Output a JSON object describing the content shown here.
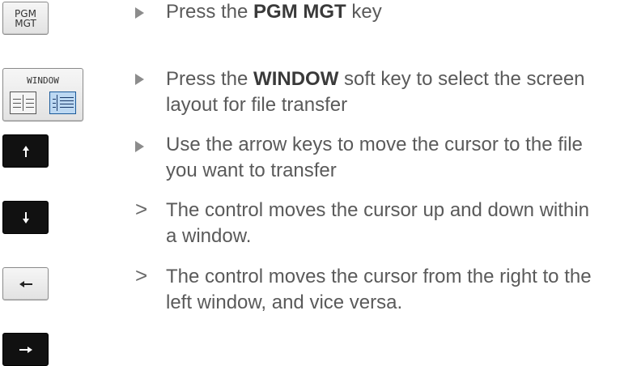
{
  "keys": {
    "pgm_mgt_line1": "PGM",
    "pgm_mgt_line2": "MGT",
    "window_softkey": "WINDOW"
  },
  "steps": [
    {
      "marker": "action",
      "pre": "Press the ",
      "bold": "PGM MGT",
      "post": " key"
    },
    {
      "marker": "action",
      "pre": "Press the ",
      "bold": "WINDOW",
      "post": " soft key to select the screen",
      "line2": "layout for file transfer"
    },
    {
      "marker": "action",
      "text": "Use the arrow keys to move the cursor to the file",
      "line2": "you want to transfer"
    },
    {
      "marker": "result",
      "symbol": ">",
      "text": "The control moves the cursor up and down within",
      "line2": "a window."
    },
    {
      "marker": "result",
      "symbol": ">",
      "text": "The control moves the cursor from the right to the",
      "line2": "left window, and vice versa."
    }
  ],
  "icons": [
    "arrow-up-icon",
    "arrow-down-icon",
    "arrow-left-icon",
    "arrow-right-icon"
  ],
  "colors": {
    "text": "#5a5a5a",
    "bold": "#3a3a3a",
    "bullet": "#8c8c8c",
    "dark_key": "#111111",
    "selected_softkey_pane": "#bcd8f2"
  }
}
